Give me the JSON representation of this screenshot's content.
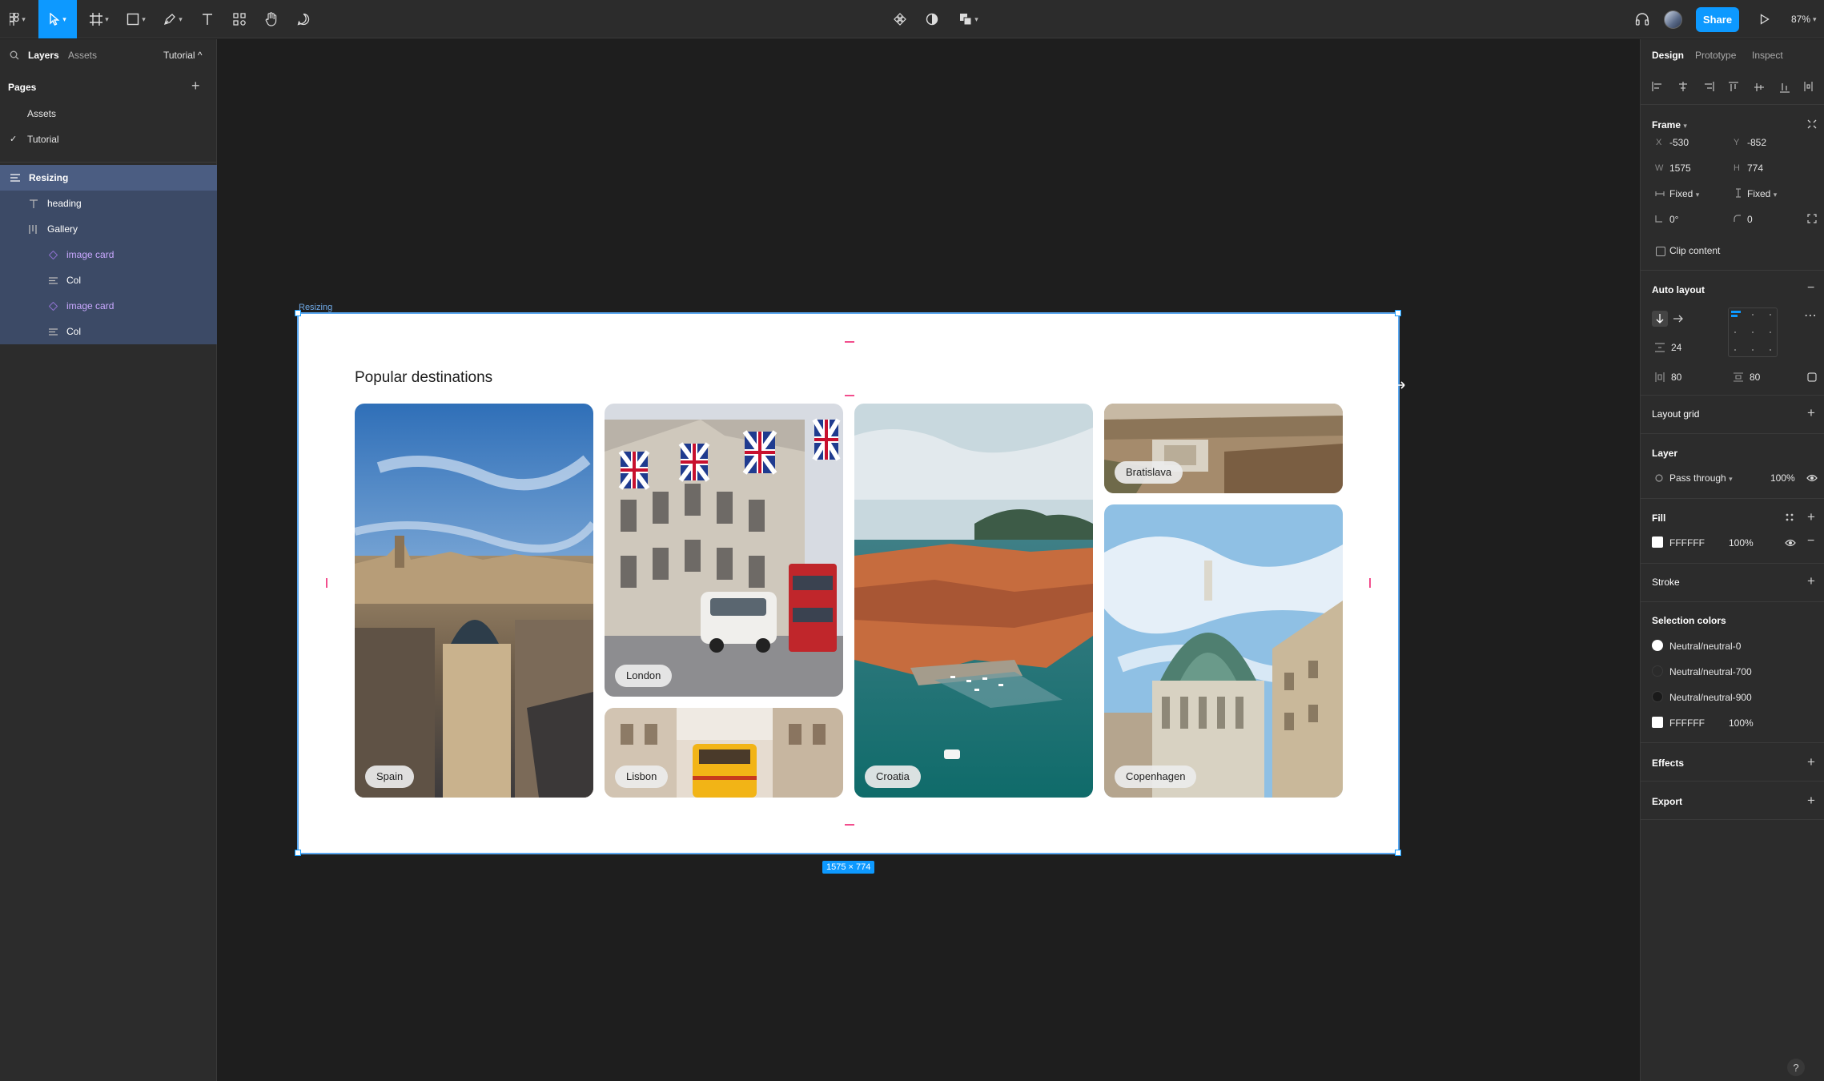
{
  "toolbar": {
    "share_label": "Share",
    "zoom_label": "87%",
    "tools": [
      "main-menu",
      "move",
      "frame",
      "shape",
      "pen",
      "text",
      "resources",
      "hand",
      "comment"
    ]
  },
  "left_panel": {
    "tabs": {
      "layers": "Layers",
      "assets": "Assets",
      "page_switch": "Tutorial ^"
    },
    "pages_title": "Pages",
    "pages": [
      {
        "label": "Assets",
        "selected": false
      },
      {
        "label": "Tutorial",
        "selected": true
      }
    ],
    "layers": [
      {
        "label": "Resizing",
        "type": "frame"
      },
      {
        "label": "heading",
        "type": "text"
      },
      {
        "label": "Gallery",
        "type": "autolayout"
      },
      {
        "label": "image card",
        "type": "component"
      },
      {
        "label": "Col",
        "type": "autolayout"
      },
      {
        "label": "image card",
        "type": "component"
      },
      {
        "label": "Col",
        "type": "autolayout"
      }
    ]
  },
  "canvas": {
    "frame_label": "Resizing",
    "heading": "Popular destinations",
    "size_badge": "1575 × 774",
    "cards": {
      "spain": "Spain",
      "london": "London",
      "lisbon": "Lisbon",
      "croatia": "Croatia",
      "bratislava": "Bratislava",
      "copenhagen": "Copenhagen"
    }
  },
  "right_panel": {
    "tabs": {
      "design": "Design",
      "prototype": "Prototype",
      "inspect": "Inspect"
    },
    "frame": {
      "title": "Frame",
      "x_label": "X",
      "x": "-530",
      "y_label": "Y",
      "y": "-852",
      "w_label": "W",
      "w": "1575",
      "h_label": "H",
      "h": "774",
      "horizontal_resizing": "Fixed",
      "vertical_resizing": "Fixed",
      "rotation": "0°",
      "corner_radius": "0",
      "clip_content": "Clip content"
    },
    "auto_layout": {
      "title": "Auto layout",
      "spacing": "24",
      "padding_horizontal": "80",
      "padding_vertical": "80"
    },
    "layout_grid": "Layout grid",
    "layer": {
      "title": "Layer",
      "blend": "Pass through",
      "opacity": "100%"
    },
    "fill": {
      "title": "Fill",
      "hex": "FFFFFF",
      "opacity": "100%",
      "color": "#FFFFFF"
    },
    "stroke": "Stroke",
    "selection_colors": {
      "title": "Selection colors",
      "items": [
        {
          "label": "Neutral/neutral-0",
          "color": "#FFFFFF"
        },
        {
          "label": "Neutral/neutral-700",
          "color": "#2B2B2B"
        },
        {
          "label": "Neutral/neutral-900",
          "color": "#1A1A1A"
        },
        {
          "label": "FFFFFF",
          "color": "#FFFFFF",
          "opacity": "100%"
        }
      ]
    },
    "effects": "Effects",
    "export": "Export",
    "help": "?"
  }
}
